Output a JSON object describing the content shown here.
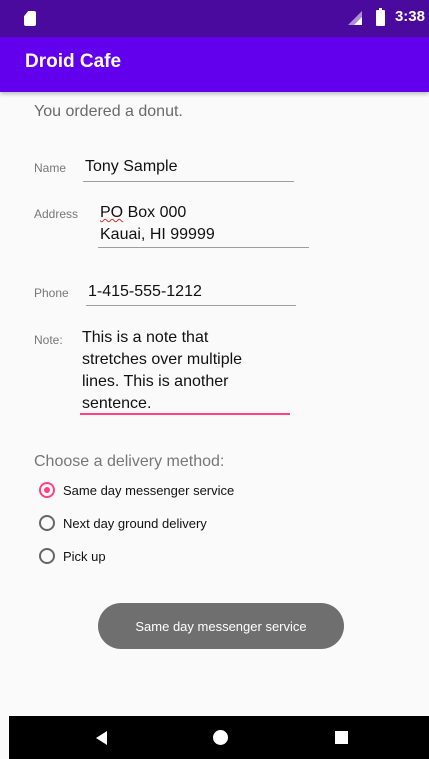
{
  "status_bar": {
    "time": "3:38",
    "icons": [
      "sim-card-icon",
      "signal-icon",
      "battery-icon"
    ]
  },
  "app_bar": {
    "title": "Droid Cafe"
  },
  "order": {
    "message": "You ordered a donut."
  },
  "form": {
    "name": {
      "label": "Name",
      "value": "Tony Sample"
    },
    "address": {
      "label": "Address",
      "line1_prefix": "PO",
      "line1_rest": " Box 000",
      "line2": "Kauai, HI 99999"
    },
    "phone": {
      "label": "Phone",
      "value": "1-415-555-1212"
    },
    "note": {
      "label": "Note:",
      "lines": [
        "This is a note that",
        "stretches over multiple",
        "lines. This is another",
        "sentence."
      ]
    }
  },
  "delivery": {
    "prompt": "Choose a delivery method:",
    "options": [
      {
        "label": "Same day messenger service",
        "checked": true
      },
      {
        "label": "Next day ground delivery",
        "checked": false
      },
      {
        "label": "Pick up",
        "checked": false
      }
    ]
  },
  "toast": {
    "message": "Same day messenger service"
  },
  "nav_bar": {
    "buttons": [
      "back-icon",
      "home-icon",
      "recents-icon"
    ]
  },
  "colors": {
    "status_bar": "#4a0a9e",
    "app_bar": "#6200ee",
    "accent": "#ff4081"
  }
}
